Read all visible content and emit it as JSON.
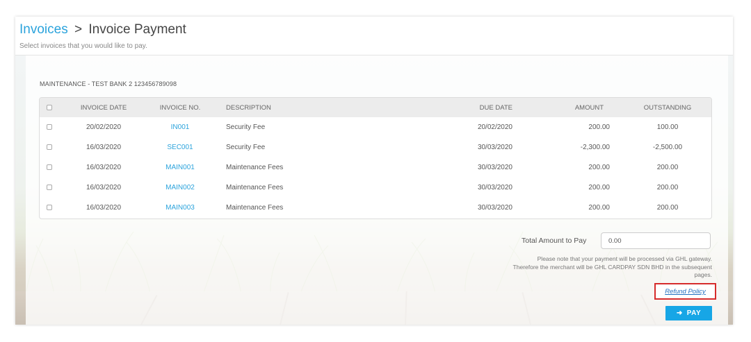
{
  "breadcrumb": {
    "parent": "Invoices",
    "separator": ">",
    "current": "Invoice Payment"
  },
  "subtitle": "Select invoices that you would like to pay.",
  "group_title": "MAINTENANCE - TEST BANK 2 123456789098",
  "table": {
    "columns": [
      "INVOICE DATE",
      "INVOICE NO.",
      "DESCRIPTION",
      "DUE DATE",
      "AMOUNT",
      "OUTSTANDING"
    ],
    "rows": [
      {
        "invoice_date": "20/02/2020",
        "invoice_no": "IN001",
        "description": "Security Fee",
        "due_date": "20/02/2020",
        "amount": "200.00",
        "outstanding": "100.00"
      },
      {
        "invoice_date": "16/03/2020",
        "invoice_no": "SEC001",
        "description": "Security Fee",
        "due_date": "30/03/2020",
        "amount": "-2,300.00",
        "outstanding": "-2,500.00"
      },
      {
        "invoice_date": "16/03/2020",
        "invoice_no": "MAIN001",
        "description": "Maintenance Fees",
        "due_date": "30/03/2020",
        "amount": "200.00",
        "outstanding": "200.00"
      },
      {
        "invoice_date": "16/03/2020",
        "invoice_no": "MAIN002",
        "description": "Maintenance Fees",
        "due_date": "30/03/2020",
        "amount": "200.00",
        "outstanding": "200.00"
      },
      {
        "invoice_date": "16/03/2020",
        "invoice_no": "MAIN003",
        "description": "Maintenance Fees",
        "due_date": "30/03/2020",
        "amount": "200.00",
        "outstanding": "200.00"
      }
    ]
  },
  "total": {
    "label": "Total Amount to Pay",
    "value": "0.00"
  },
  "note": "Please note that your payment will be processed via GHL gateway. Therefore the merchant will be GHL CARDPAY SDN BHD in the subsequent pages.",
  "refund_policy": "Refund Policy",
  "pay_button": {
    "label": "PAY",
    "icon": "arrow-right-icon"
  },
  "colors": {
    "link": "#2ba3dc",
    "pay_button": "#17a6e6",
    "highlight_border": "#d62b2b"
  }
}
